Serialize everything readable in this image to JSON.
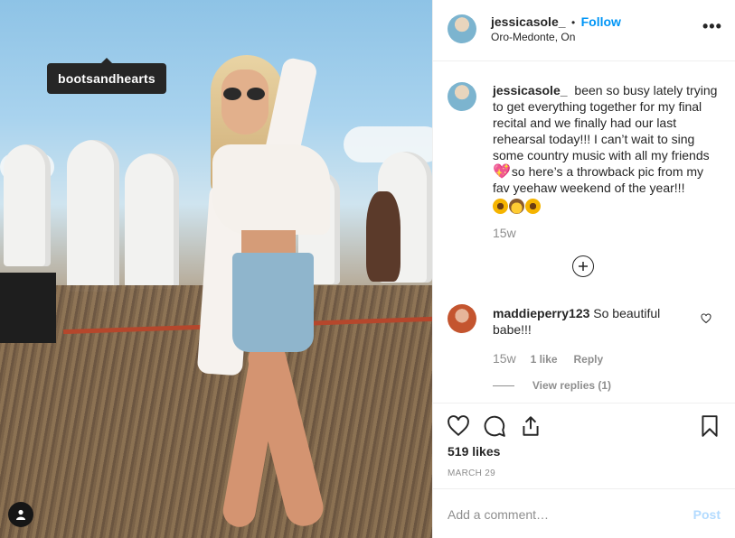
{
  "photo": {
    "tag": "bootsandhearts"
  },
  "header": {
    "username": "jessicasole_",
    "separator": "•",
    "follow": "Follow",
    "location": "Oro-Medonte, On",
    "more": "•••"
  },
  "caption": {
    "username": "jessicasole_",
    "text_part1": "been so busy lately trying to get everything together for my final recital and we finally had our last rehearsal today!!! I can’t wait to sing some country music with all my friends",
    "heart": "💖",
    "text_part2": "so here’s a throwback pic from my fav yeehaw weekend of the year!!!",
    "emojis": [
      "🌻",
      "🤠",
      "🌻"
    ],
    "time": "15w"
  },
  "comment": {
    "username": "maddieperry123",
    "text": "So beautiful babe!!!",
    "time": "15w",
    "likes": "1 like",
    "reply": "Reply",
    "view_replies": "View replies (1)"
  },
  "actions": {
    "likes": "519 likes",
    "date": "MARCH 29"
  },
  "add_comment": {
    "placeholder": "Add a comment…",
    "post": "Post"
  },
  "colors": {
    "link_blue": "#0095f6",
    "post_disabled": "#b3dbff",
    "muted": "#8e8e8e",
    "text": "#262626"
  },
  "icons": [
    "user-tag-icon",
    "more-icon",
    "add-comment-icon",
    "heart-icon",
    "comment-icon",
    "share-icon",
    "bookmark-icon"
  ]
}
